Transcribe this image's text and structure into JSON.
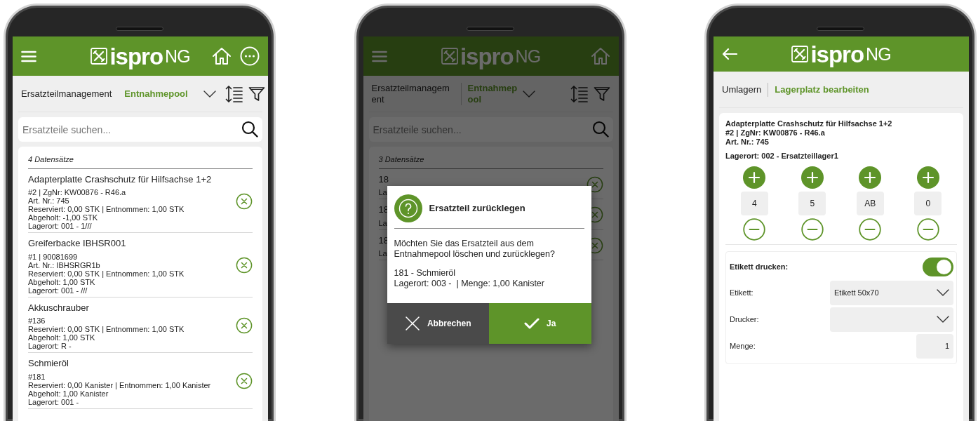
{
  "phones": [
    {
      "kind": "list",
      "header": {
        "nav": {
          "kind": "menu"
        },
        "logo": {
          "brand": "ispro",
          "suffix": "NG"
        },
        "actions": [
          {
            "kind": "home"
          },
          {
            "kind": "more"
          }
        ]
      },
      "breadcrumb": {
        "parent": "Ersatzteilmanagement",
        "current": "Entnahmepool",
        "wrap": false
      },
      "search": {
        "placeholder": "Ersatzteile suchen..."
      },
      "count": "4 Datensätze",
      "items": [
        {
          "title": "Adapterplatte Crashschutz für Hilfsachse 1+2",
          "lines": [
            "#2 | ZgNr: KW00876 - R46.a",
            "Art. Nr.: 745",
            "Reserviert: 0,00 STK | Entnommen: 1,00 STK",
            "Abgeholt: -1,00 STK",
            "Lagerort: 001 - 1///"
          ]
        },
        {
          "title": "Greiferbacke IBHSR001",
          "lines": [
            "#1 | 90081699",
            "Art. Nr.: IBHSRGR1b",
            "Reserviert: 0,00 STK | Entnommen: 1,00 STK",
            "Abgeholt: 1,00 STK",
            "Lagerort: 001 - ///"
          ]
        },
        {
          "title": "Akkuschrauber",
          "lines": [
            "#136",
            "Reserviert: 0,00 STK | Entnommen: 1,00 STK",
            "Abgeholt: 1,00 STK",
            "Lagerort: R -"
          ]
        },
        {
          "title": "Schmieröl",
          "lines": [
            "#181",
            "Reserviert: 0,00 Kanister | Entnommen: 1,00 Kanister",
            "Abgeholt: 1,00 Kanister",
            "Lagerort: 001 -"
          ]
        }
      ]
    },
    {
      "kind": "list",
      "dimmed": true,
      "header": {
        "nav": {
          "kind": "menu"
        },
        "logo": {
          "brand": "ispro",
          "suffix": "NG"
        },
        "actions": [
          {
            "kind": "home"
          }
        ]
      },
      "breadcrumb": {
        "parent": "Ersatzteilmanagement",
        "current": "Entnahmepool",
        "wrap": true
      },
      "search": {
        "placeholder": "Ersatzteile suchen..."
      },
      "count": "3 Datensätze",
      "items": [
        {
          "title": "18",
          "lines": [
            "La"
          ]
        },
        {
          "title": "18",
          "lines": [
            "La"
          ]
        },
        {
          "title": "18",
          "lines": [
            "La"
          ]
        }
      ],
      "dialog": {
        "title": "Ersatzteil zurücklegen",
        "message": "Möchten Sie das Ersatzteil aus dem Entnahmepool löschen und zurücklegen?",
        "details": [
          "181 - Schmieröl",
          "Lagerort: 003 -  | Menge: 1,00 Kanister"
        ],
        "buttons": [
          {
            "kind": "cancel",
            "label": "Abbrechen"
          },
          {
            "kind": "confirm",
            "label": "Ja"
          }
        ]
      }
    },
    {
      "kind": "edit",
      "header": {
        "nav": {
          "kind": "back"
        },
        "logo": {
          "brand": "ispro",
          "suffix": "NG"
        }
      },
      "breadcrumb": {
        "parent": "Umlagern",
        "current": "Lagerplatz bearbeiten",
        "wrap": false
      },
      "article": {
        "lines": [
          "Adapterplatte Crashschutz für Hilfsachse 1+2",
          "#2 | ZgNr: KW00876 - R46.a",
          "Art. Nr.: 745"
        ],
        "location": "Lagerort: 002 - Ersatzteillager1"
      },
      "spinners": [
        {
          "value": "4"
        },
        {
          "value": "5"
        },
        {
          "value": "AB"
        },
        {
          "value": "0"
        }
      ],
      "print": {
        "label": "Etikett drucken:",
        "on": true,
        "fields": [
          {
            "kind": "select",
            "label": "Etikett:",
            "value": "Etikett 50x70"
          },
          {
            "kind": "select",
            "label": "Drucker:"
          },
          {
            "kind": "number",
            "label": "Menge:",
            "value": "1"
          }
        ]
      }
    }
  ]
}
